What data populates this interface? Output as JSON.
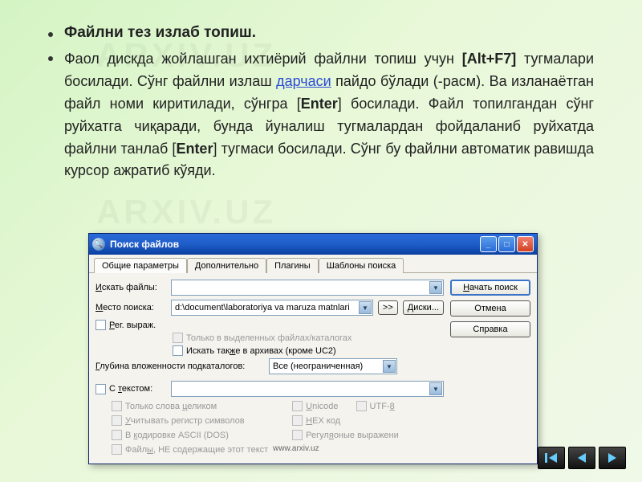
{
  "watermark": "ARXIV.UZ",
  "bullet1": {
    "heading": "Файлни тез излаб топиш."
  },
  "bullet2": {
    "pre": "Фаол дискда жойлашган ихтиёрий файлни топиш учун ",
    "hotkey": "[Alt+F7]",
    "mid1": " тугмалари босилади. Сўнг файлни излаш ",
    "link": "дарчаси",
    "mid2": " пайдо бўлади (-расм). Ва изланаётган файл номи киритилади, сўнгра [",
    "enter1": "Enter",
    "mid3": "] босилади. Файл топилгандан сўнг руйхатга чиқаради, бунда йуналиш тугмалардан фойдаланиб руйхатда файлни танлаб [",
    "enter2": "Enter",
    "mid4": "] тугмаси босилади. Сўнг бу файлни автоматик равишда курсор ажратиб кўяди."
  },
  "dialog": {
    "title": "Поиск файлов",
    "tabs": [
      "Общие параметры",
      "Дополнительно",
      "Плагины",
      "Шаблоны поиска"
    ],
    "active_tab": 0,
    "labels": {
      "search_files": "Искать файлы:",
      "search_location": "Место поиска:",
      "regex": "Рег. выраж.",
      "only_selected": "Только в выделенных файлах/каталогах",
      "search_archives": "Искать также в архивах (кроме UC2)",
      "depth": "Глубина вложенности подкаталогов:",
      "with_text": "С текстом:",
      "whole_words": "Только слова целиком",
      "case_sensitive": "Учитывать регистр символов",
      "ascii": "В кодировке ASCII (DOS)",
      "not_containing": "Файлы, НЕ содержащие этот текст",
      "unicode": "Unicode",
      "hex": "HEX код",
      "regex2": "Регуляоные выражени",
      "utf8": "UTF-8"
    },
    "values": {
      "search_files": "",
      "location": "d:\\document\\laboratoriya va maruza matnlari",
      "depth": "Все (неограниченная)",
      "text": ""
    },
    "buttons": {
      "expand": ">>",
      "disks": "Диски...",
      "start": "Начать поиск",
      "cancel": "Отмена",
      "help": "Справка"
    }
  },
  "footer_url": "www.arxiv.uz",
  "nav": {
    "first": "first",
    "prev": "prev",
    "next": "next"
  }
}
